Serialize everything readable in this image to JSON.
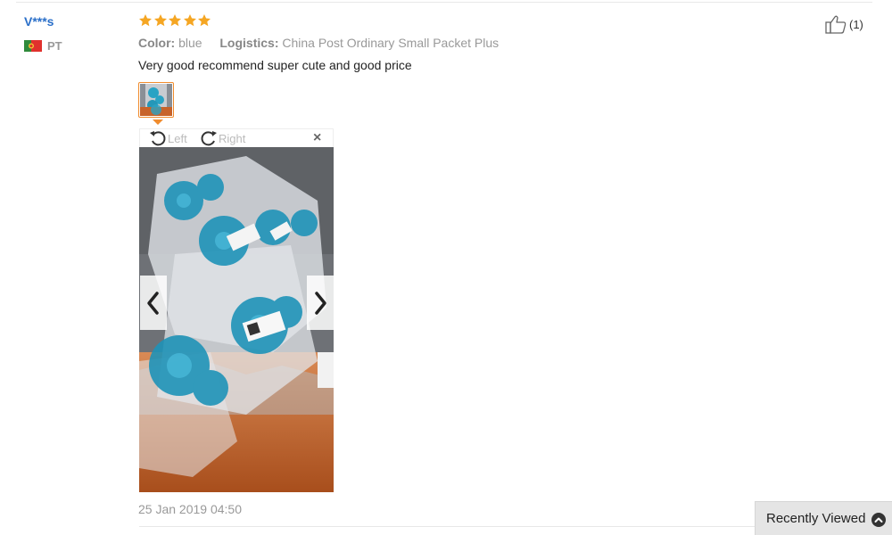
{
  "review": {
    "user_name": "V***s",
    "country_code": "PT",
    "rating": 5,
    "props": [
      {
        "label": "Color:",
        "value": "blue"
      },
      {
        "label": "Logistics:",
        "value": "China Post Ordinary Small Packet Plus"
      }
    ],
    "text": "Very good recommend super cute and good price",
    "date": "25 Jan 2019 04:50",
    "likes": "(1)"
  },
  "viewer": {
    "rotate_left_label": "Left",
    "rotate_right_label": "Right",
    "close_glyph": "×"
  },
  "recently_viewed": {
    "label": "Recently Viewed"
  },
  "icons": {
    "star": "star-icon",
    "flag": "portugal-flag-icon",
    "rotate_left": "rotate-left-icon",
    "rotate_right": "rotate-right-icon",
    "thumbs_up": "thumbs-up-icon",
    "prev": "chevron-left-icon",
    "next": "chevron-right-icon",
    "expand": "chevron-up-icon"
  },
  "colors": {
    "accent_orange": "#f08c2e",
    "link_blue": "#2a6fc9",
    "star": "#f5a623"
  }
}
